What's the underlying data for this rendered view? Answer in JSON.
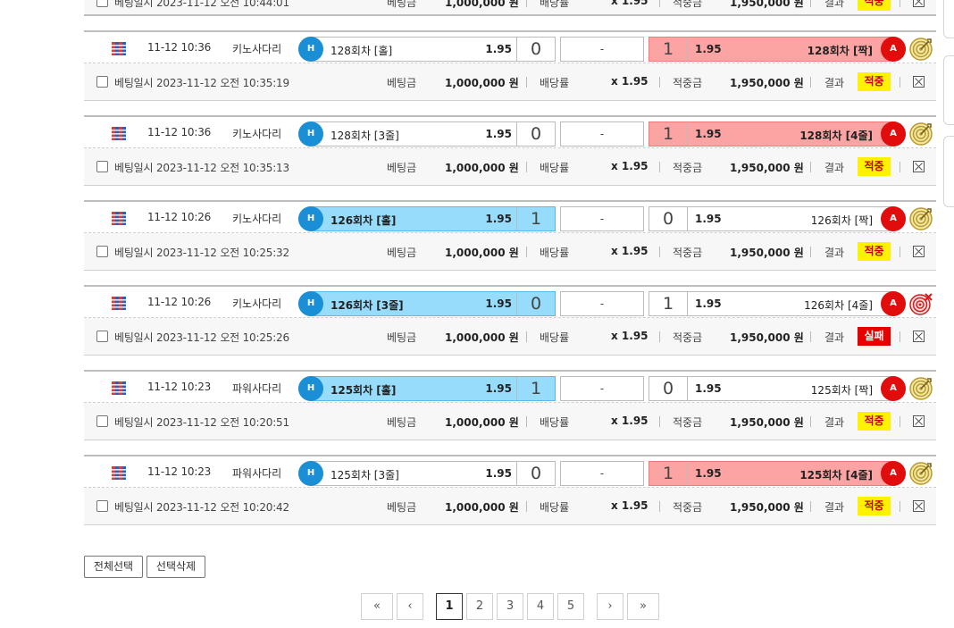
{
  "colors": {
    "home_selected": "#97dcfb",
    "away_selected": "#fca4a4",
    "home_badge": "#1a8fd6",
    "away_badge": "#e10d0d",
    "win_badge": "#fff200",
    "lose_badge": "#e70000"
  },
  "labels": {
    "bet_date_prefix": "베팅일시",
    "bet_amount": "베팅금",
    "odds_rate": "배당률",
    "win_amount": "적중금",
    "result": "결과",
    "home_badge": "H",
    "away_badge": "A",
    "draw": "-"
  },
  "partial_row": {
    "bet_date": "베팅일시 2023-11-12 오전 10:44:01",
    "bet_amount": "1,000,000 원",
    "odds": "x 1.95",
    "win_amount": "1,950,000 원",
    "status": "적중"
  },
  "bets": [
    {
      "datetime": "11-12 10:36",
      "league": "키노사다리",
      "flag_icon": "flag-icon",
      "home_name": "128회차 [홀]",
      "home_odd": "1.95",
      "home_score": "0",
      "home_selected": false,
      "draw": "-",
      "away_score": "1",
      "away_odd": "1.95",
      "away_name": "128회차 [짝]",
      "away_selected": true,
      "result_icon": "target-hit-icon",
      "bet_date": "베팅일시 2023-11-12 오전 10:35:19",
      "bet_amount": "1,000,000 원",
      "odds": "x 1.95",
      "win_amount": "1,950,000 원",
      "status": "적중",
      "status_type": "win"
    },
    {
      "datetime": "11-12 10:36",
      "league": "키노사다리",
      "flag_icon": "flag-icon",
      "home_name": "128회차 [3줄]",
      "home_odd": "1.95",
      "home_score": "0",
      "home_selected": false,
      "draw": "-",
      "away_score": "1",
      "away_odd": "1.95",
      "away_name": "128회차 [4줄]",
      "away_selected": true,
      "result_icon": "target-hit-icon",
      "bet_date": "베팅일시 2023-11-12 오전 10:35:13",
      "bet_amount": "1,000,000 원",
      "odds": "x 1.95",
      "win_amount": "1,950,000 원",
      "status": "적중",
      "status_type": "win"
    },
    {
      "datetime": "11-12 10:26",
      "league": "키노사다리",
      "flag_icon": "flag-icon",
      "home_name": "126회차 [홀]",
      "home_odd": "1.95",
      "home_score": "1",
      "home_selected": true,
      "draw": "-",
      "away_score": "0",
      "away_odd": "1.95",
      "away_name": "126회차 [짝]",
      "away_selected": false,
      "result_icon": "target-hit-icon",
      "bet_date": "베팅일시 2023-11-12 오전 10:25:32",
      "bet_amount": "1,000,000 원",
      "odds": "x 1.95",
      "win_amount": "1,950,000 원",
      "status": "적중",
      "status_type": "win"
    },
    {
      "datetime": "11-12 10:26",
      "league": "키노사다리",
      "flag_icon": "flag-icon",
      "home_name": "126회차 [3줄]",
      "home_odd": "1.95",
      "home_score": "0",
      "home_selected": true,
      "draw": "-",
      "away_score": "1",
      "away_odd": "1.95",
      "away_name": "126회차 [4줄]",
      "away_selected": false,
      "result_icon": "target-miss-icon",
      "bet_date": "베팅일시 2023-11-12 오전 10:25:26",
      "bet_amount": "1,000,000 원",
      "odds": "x 1.95",
      "win_amount": "1,950,000 원",
      "status": "실패",
      "status_type": "lose"
    },
    {
      "datetime": "11-12 10:23",
      "league": "파워사다리",
      "flag_icon": "flag-icon",
      "home_name": "125회차 [홀]",
      "home_odd": "1.95",
      "home_score": "1",
      "home_selected": true,
      "draw": "-",
      "away_score": "0",
      "away_odd": "1.95",
      "away_name": "125회차 [짝]",
      "away_selected": false,
      "result_icon": "target-hit-icon",
      "bet_date": "베팅일시 2023-11-12 오전 10:20:51",
      "bet_amount": "1,000,000 원",
      "odds": "x 1.95",
      "win_amount": "1,950,000 원",
      "status": "적중",
      "status_type": "win"
    },
    {
      "datetime": "11-12 10:23",
      "league": "파워사다리",
      "flag_icon": "flag-icon",
      "home_name": "125회차 [3줄]",
      "home_odd": "1.95",
      "home_score": "0",
      "home_selected": false,
      "draw": "-",
      "away_score": "1",
      "away_odd": "1.95",
      "away_name": "125회차 [4줄]",
      "away_selected": true,
      "result_icon": "target-hit-icon",
      "bet_date": "베팅일시 2023-11-12 오전 10:20:42",
      "bet_amount": "1,000,000 원",
      "odds": "x 1.95",
      "win_amount": "1,950,000 원",
      "status": "적중",
      "status_type": "win"
    }
  ],
  "actions": {
    "select_all": "전체선택",
    "delete_selected": "선택삭제"
  },
  "pagination": {
    "first": "«",
    "prev": "‹",
    "pages": [
      "1",
      "2",
      "3",
      "4",
      "5"
    ],
    "current": "1",
    "next": "›",
    "last": "»"
  }
}
